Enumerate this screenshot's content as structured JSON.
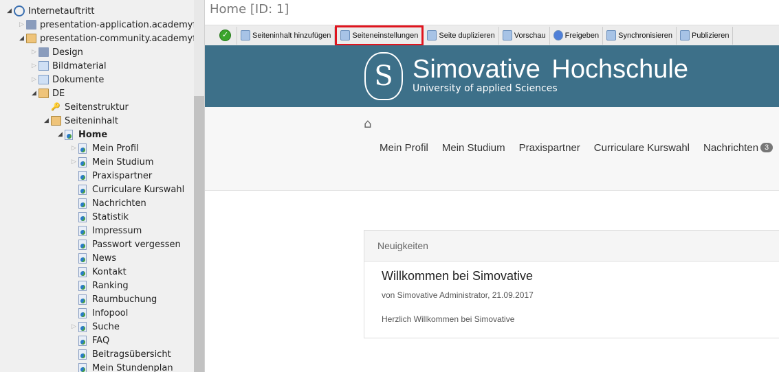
{
  "tree": [
    {
      "label": "Internetauftritt",
      "level": 0,
      "icon": "globe-icon",
      "arrow": "open"
    },
    {
      "label": "presentation-application.academyfive",
      "level": 1,
      "icon": "folder-icon",
      "arrow": "closed"
    },
    {
      "label": "presentation-community.academyfive",
      "level": 1,
      "icon": "folder-open-icon",
      "arrow": "open"
    },
    {
      "label": "Design",
      "level": 2,
      "icon": "folder-icon",
      "arrow": "closed"
    },
    {
      "label": "Bildmaterial",
      "level": 2,
      "icon": "image-icon",
      "arrow": "closed"
    },
    {
      "label": "Dokumente",
      "level": 2,
      "icon": "documents-icon",
      "arrow": "closed"
    },
    {
      "label": "DE",
      "level": 2,
      "icon": "folder-open-icon",
      "arrow": "open"
    },
    {
      "label": "Seitenstruktur",
      "level": 3,
      "icon": "key-icon",
      "arrow": ""
    },
    {
      "label": "Seiteninhalt",
      "level": 3,
      "icon": "folder-open-icon",
      "arrow": "open"
    },
    {
      "label": "Home",
      "level": 4,
      "icon": "page-icon",
      "arrow": "open",
      "bold": true
    },
    {
      "label": "Mein Profil",
      "level": 5,
      "icon": "page-icon",
      "arrow": "closed"
    },
    {
      "label": "Mein Studium",
      "level": 5,
      "icon": "page-icon",
      "arrow": "closed"
    },
    {
      "label": "Praxispartner",
      "level": 5,
      "icon": "page-icon",
      "arrow": ""
    },
    {
      "label": "Curriculare Kurswahl",
      "level": 5,
      "icon": "page-icon",
      "arrow": ""
    },
    {
      "label": "Nachrichten",
      "level": 5,
      "icon": "page-icon",
      "arrow": ""
    },
    {
      "label": "Statistik",
      "level": 5,
      "icon": "page-icon",
      "arrow": ""
    },
    {
      "label": "Impressum",
      "level": 5,
      "icon": "page-icon",
      "arrow": ""
    },
    {
      "label": "Passwort vergessen",
      "level": 5,
      "icon": "page-icon",
      "arrow": ""
    },
    {
      "label": "News",
      "level": 5,
      "icon": "page-icon",
      "arrow": ""
    },
    {
      "label": "Kontakt",
      "level": 5,
      "icon": "page-icon",
      "arrow": ""
    },
    {
      "label": "Ranking",
      "level": 5,
      "icon": "page-icon",
      "arrow": ""
    },
    {
      "label": "Raumbuchung",
      "level": 5,
      "icon": "page-icon",
      "arrow": ""
    },
    {
      "label": "Infopool",
      "level": 5,
      "icon": "page-icon",
      "arrow": ""
    },
    {
      "label": "Suche",
      "level": 5,
      "icon": "page-icon",
      "arrow": "closed"
    },
    {
      "label": "FAQ",
      "level": 5,
      "icon": "page-icon",
      "arrow": ""
    },
    {
      "label": "Beitragsübersicht",
      "level": 5,
      "icon": "page-icon",
      "arrow": ""
    },
    {
      "label": "Mein Stundenplan",
      "level": 5,
      "icon": "page-icon",
      "arrow": ""
    }
  ],
  "title": "Home [ID: 1]",
  "toolbar": [
    {
      "label": "",
      "icon": "check-icon"
    },
    {
      "label": "Seiteninhalt hinzufügen",
      "icon": "add-content-icon"
    },
    {
      "label": "Seiteneinstellungen",
      "icon": "settings-icon",
      "highlighted": true
    },
    {
      "label": "Seite duplizieren",
      "icon": "duplicate-icon"
    },
    {
      "label": "Vorschau",
      "icon": "preview-icon"
    },
    {
      "label": "Freigeben",
      "icon": "approve-icon"
    },
    {
      "label": "Synchronisieren",
      "icon": "sync-icon"
    },
    {
      "label": "Publizieren",
      "icon": "publish-icon"
    }
  ],
  "banner": {
    "title": "Simovative Hochschule",
    "subtitle": "University of applied Sciences",
    "color": "#3d7089"
  },
  "nav": {
    "links": [
      "Mein Profil",
      "Mein Studium",
      "Praxispartner",
      "Curriculare Kurswahl",
      "Nachrichten"
    ],
    "badge": "3"
  },
  "news": {
    "header": "Neuigkeiten",
    "title": "Willkommen bei Simovative",
    "meta": "von Simovative Administrator, 21.09.2017",
    "body": "Herzlich Willkommen bei Simovative"
  }
}
